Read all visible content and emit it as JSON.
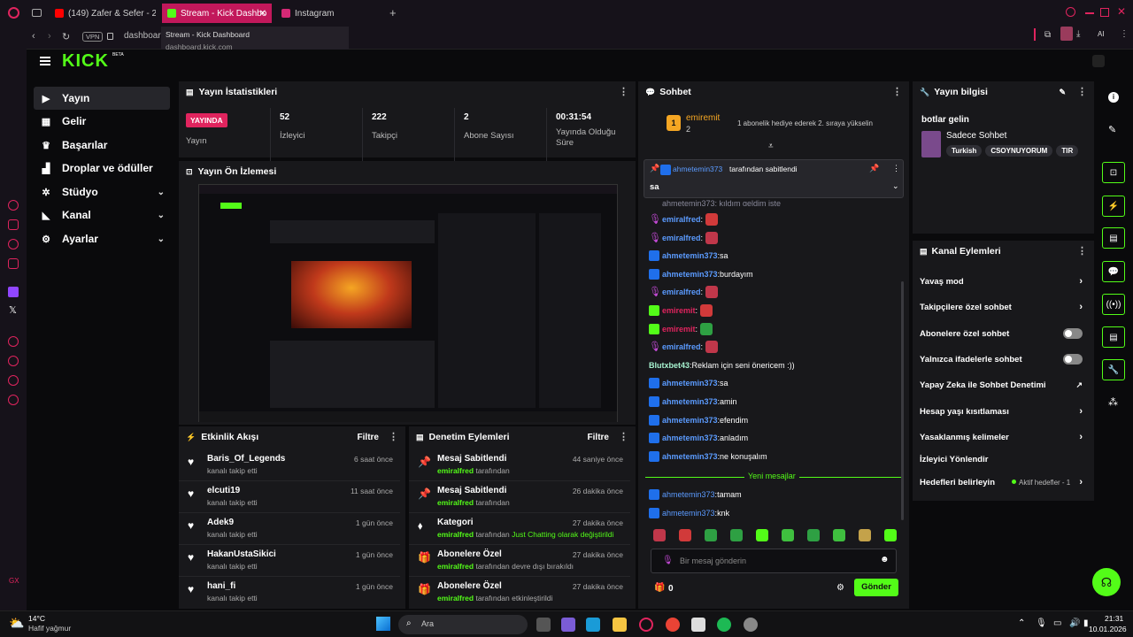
{
  "browser": {
    "tabs": [
      {
        "label": "(149) Zafer & Sefer - 2..."
      },
      {
        "label": "Stream - Kick Dashbo"
      },
      {
        "label": "Instagram"
      }
    ],
    "vpn": "VPN",
    "address": "dashboard",
    "tooltip_title": "Stream - Kick Dashboard",
    "tooltip_url": "dashboard.kick.com",
    "ai_label": "AI"
  },
  "brand": {
    "logo": "KICK",
    "beta": "BETA"
  },
  "nav": [
    {
      "label": "Yayın",
      "icon": "stream-icon"
    },
    {
      "label": "Gelir",
      "icon": "revenue-icon"
    },
    {
      "label": "Başarılar",
      "icon": "trophy-icon"
    },
    {
      "label": "Droplar ve ödüller",
      "icon": "drops-icon"
    },
    {
      "label": "Stüdyo",
      "icon": "studio-icon"
    },
    {
      "label": "Kanal",
      "icon": "channel-icon"
    },
    {
      "label": "Ayarlar",
      "icon": "settings-icon"
    }
  ],
  "stats": {
    "title": "Yayın İstatistikleri",
    "live": "YAYINDA",
    "live_label": "Yayın",
    "items": [
      {
        "value": "52",
        "label": "İzleyici"
      },
      {
        "value": "222",
        "label": "Takipçi"
      },
      {
        "value": "2",
        "label": "Abone Sayısı"
      },
      {
        "value": "00:31:54",
        "label": "Yayında Olduğu Süre"
      }
    ]
  },
  "preview": {
    "title": "Yayın Ön İzlemesi"
  },
  "activity": {
    "title": "Etkinlik Akışı",
    "filter": "Filtre",
    "items": [
      {
        "name": "Baris_Of_Legends",
        "sub": "kanalı takip etti",
        "time": "6 saat önce"
      },
      {
        "name": "elcuti19",
        "sub": "kanalı takip etti",
        "time": "11 saat önce"
      },
      {
        "name": "Adek9",
        "sub": "kanalı takip etti",
        "time": "1 gün önce"
      },
      {
        "name": "HakanUstaSikici",
        "sub": "kanalı takip etti",
        "time": "1 gün önce"
      },
      {
        "name": "hani_fi",
        "sub": "kanalı takip etti",
        "time": "1 gün önce"
      }
    ]
  },
  "moderation": {
    "title": "Denetim Eylemleri",
    "filter": "Filtre",
    "items": [
      {
        "name": "Mesaj Sabitlendi",
        "user": "emiralfred",
        "sub": "tarafından",
        "extra": "",
        "time": "44 saniye önce"
      },
      {
        "name": "Mesaj Sabitlendi",
        "user": "emiralfred",
        "sub": "tarafından",
        "extra": "",
        "time": "26 dakika önce"
      },
      {
        "name": "Kategori",
        "user": "emiralfred",
        "sub": "tarafından",
        "extra": "Just Chatting olarak değiştirildi",
        "time": "27 dakika önce"
      },
      {
        "name": "Abonelere Özel",
        "user": "emiralfred",
        "sub": "tarafından devre dışı bırakıldı",
        "extra": "",
        "time": "27 dakika önce"
      },
      {
        "name": "Abonelere Özel",
        "user": "emiralfred",
        "sub": "tarafından etkinleştirildi",
        "extra": "",
        "time": "27 dakika önce"
      }
    ]
  },
  "chat": {
    "title": "Sohbet",
    "gift_user": "emiremit",
    "gift_count": "2",
    "gift_text": "1 abonelik hediye ederek 2. sıraya yükselin",
    "pinned_by": "ahmetemin373",
    "pinned_label": "tarafından sabitlendi",
    "pinned_msg": "sa",
    "partial": "ahmetemin373: kıldım geldim işte",
    "messages": [
      {
        "user": "emiralfred",
        "text": "",
        "badge": "m",
        "color": "#5b9bff",
        "emote": "#d13a3a"
      },
      {
        "user": "emiralfred",
        "text": "",
        "badge": "m",
        "color": "#5b9bff",
        "emote": "#c0374a"
      },
      {
        "user": "ahmetemin373",
        "text": "sa",
        "badge": "k",
        "color": "#5b9bff",
        "emote": ""
      },
      {
        "user": "ahmetemin373",
        "text": "burdayım",
        "badge": "k",
        "color": "#5b9bff",
        "emote": ""
      },
      {
        "user": "emiralfred",
        "text": "",
        "badge": "m",
        "color": "#5b9bff",
        "emote": "#c0374a"
      },
      {
        "user": "emiremit",
        "text": "",
        "badge": "g",
        "color": "#e0245e",
        "emote": "#d13a3a"
      },
      {
        "user": "emiremit",
        "text": "",
        "badge": "g",
        "color": "#e0245e",
        "emote": "#2ea043"
      },
      {
        "user": "emiralfred",
        "text": "",
        "badge": "m",
        "color": "#5b9bff",
        "emote": "#c0374a"
      },
      {
        "user": "Blutxbet43",
        "text": "Reklam için seni önericem :))",
        "badge": "",
        "color": "#a7f3d0",
        "emote": ""
      },
      {
        "user": "ahmetemin373",
        "text": "sa",
        "badge": "k",
        "color": "#5b9bff",
        "emote": ""
      },
      {
        "user": "ahmetemin373",
        "text": "amin",
        "badge": "k",
        "color": "#5b9bff",
        "emote": ""
      },
      {
        "user": "ahmetemin373",
        "text": "efendim",
        "badge": "k",
        "color": "#5b9bff",
        "emote": ""
      },
      {
        "user": "ahmetemin373",
        "text": "anladım",
        "badge": "k",
        "color": "#5b9bff",
        "emote": ""
      },
      {
        "user": "ahmetemin373",
        "text": "ne konuşalım",
        "badge": "k",
        "color": "#5b9bff",
        "emote": ""
      }
    ],
    "new_messages": "Yeni mesajlar",
    "new": [
      {
        "user": "ahmetemin373",
        "text": "tamam"
      },
      {
        "user": "ahmetemin373",
        "text": "knk"
      }
    ],
    "placeholder": "Bir mesaj gönderin",
    "points": "0",
    "send": "Gönder"
  },
  "stream_info": {
    "title": "Yayın bilgisi",
    "stream_title": "botlar gelin",
    "category": "Sadece Sohbet",
    "tags": [
      "Turkish",
      "CSOYNUYORUM",
      "TIR"
    ]
  },
  "channel_actions": {
    "title": "Kanal Eylemleri",
    "items": [
      {
        "label": "Yavaş mod",
        "type": "chevron"
      },
      {
        "label": "Takipçilere özel sohbet",
        "type": "chevron"
      },
      {
        "label": "Abonelere özel sohbet",
        "type": "toggle"
      },
      {
        "label": "Yalnızca ifadelerle sohbet",
        "type": "toggle"
      },
      {
        "label": "Yapay Zeka ile Sohbet Denetimi",
        "type": "external"
      },
      {
        "label": "Hesap yaşı kısıtlaması",
        "type": "chevron"
      },
      {
        "label": "Yasaklanmış kelimeler",
        "type": "chevron"
      },
      {
        "label": "İzleyici Yönlendir",
        "type": "none"
      },
      {
        "label": "Hedefleri belirleyin",
        "type": "goal"
      }
    ],
    "goal_status": "Aktif hedefler - 1"
  },
  "taskbar": {
    "temp": "14°C",
    "weather": "Hafif yağmur",
    "search": "Ara",
    "time": "21:31",
    "date": "10.01.2026"
  },
  "colors": {
    "accent": "#53fc18",
    "live": "#e0245e",
    "panel": "#18181b"
  }
}
